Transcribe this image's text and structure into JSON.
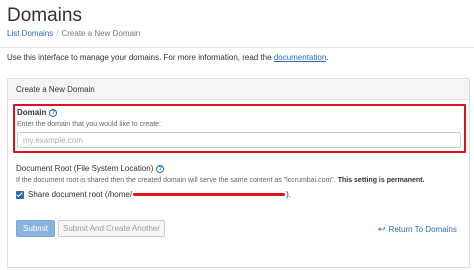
{
  "header": {
    "title": "Domains",
    "breadcrumb": {
      "link": "List Domains",
      "separator": "/",
      "current": "Create a New Domain"
    }
  },
  "intro": {
    "text": "Use this interface to manage your domains. For more information, read the ",
    "link": "documentation",
    "suffix": "."
  },
  "panel": {
    "heading": "Create a New Domain",
    "domain": {
      "label": "Domain",
      "hint": "Enter the domain that you would like to create:",
      "placeholder": "my.example.com",
      "value": ""
    },
    "document_root": {
      "label": "Document Root (File System Location)",
      "hint_prefix": "If the document root is shared then the created domain will serve the same content as \"lccrumbai.com\".",
      "hint_bold": "This setting is permanent.",
      "share_label_prefix": "Share document root (/home/",
      "share_label_suffix": ").",
      "share_checked": true
    },
    "buttons": {
      "submit": "Submit",
      "submit_and_create": "Submit And Create Another",
      "return": "Return To Domains"
    }
  },
  "colors": {
    "link": "#2a6bb5",
    "highlight": "#d9141c",
    "submit_bg": "#8ab3e0"
  },
  "icons": {
    "help": "help-circle-icon",
    "back": "back-arrow-icon"
  }
}
